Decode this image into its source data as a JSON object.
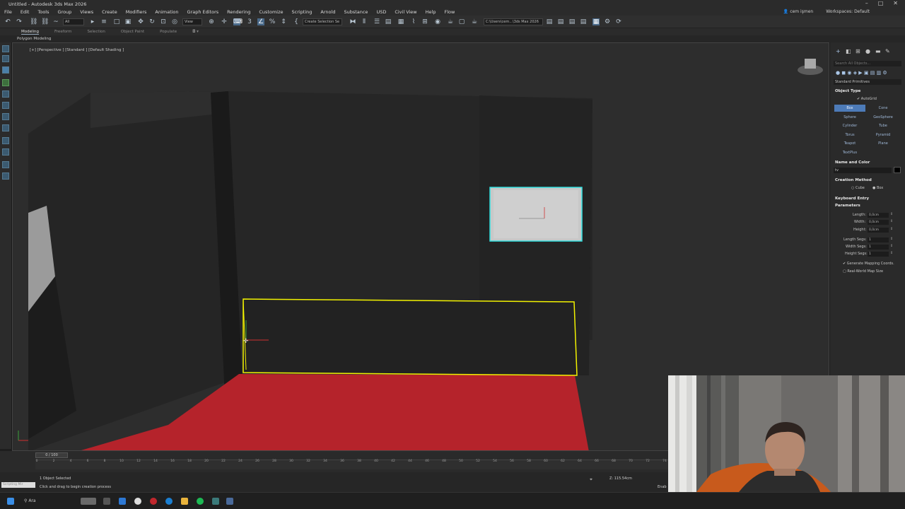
{
  "window": {
    "title": "Untitled - Autodesk 3ds Max 2026"
  },
  "menu": {
    "items": [
      "File",
      "Edit",
      "Tools",
      "Group",
      "Views",
      "Create",
      "Modifiers",
      "Animation",
      "Graph Editors",
      "Rendering",
      "Customize",
      "Scripting",
      "Arnold",
      "Substance",
      "USD",
      "Civil View",
      "Help",
      "Flow"
    ],
    "user": "cem işmen",
    "workspaces_label": "Workspaces:",
    "workspace": "Default"
  },
  "toolbar": {
    "filter": "All",
    "view_dropdown": "View",
    "selection_set": "Create Selection Se",
    "project_path": "C:\\Users\\cem...\\3ds Max 2026"
  },
  "ribbon": {
    "tabs": [
      "Modeling",
      "Freeform",
      "Selection",
      "Object Paint",
      "Populate"
    ],
    "active_tab": "Modeling",
    "sub_label": "Polygon Modeling"
  },
  "viewport": {
    "label": "[+] [Perspective ] [Standard ] [Default Shading ]",
    "filter_icon": "funnel-icon"
  },
  "command_panel": {
    "search_placeholder": "Search All Objects...",
    "category": "Standard Primitives",
    "object_type_header": "Object Type",
    "autogrid_label": "AutoGrid",
    "object_buttons": [
      "Box",
      "Cone",
      "Sphere",
      "GeoSphere",
      "Cylinder",
      "Tube",
      "Torus",
      "Pyramid",
      "Teapot",
      "Plane",
      "TextPlus"
    ],
    "active_button": "Box",
    "name_color_header": "Name and Color",
    "name_value": "tv",
    "object_color": "#000000",
    "creation_method_header": "Creation Method",
    "creation_cube": "Cube",
    "creation_box": "Box",
    "keyboard_entry_header": "Keyboard Entry",
    "parameters_header": "Parameters",
    "length_label": "Length:",
    "length_value": "0,0cm",
    "width_label": "Width:",
    "width_value": "0,0cm",
    "height_label": "Height:",
    "height_value": "0,0cm",
    "length_segs_label": "Length Segs:",
    "length_segs_value": "1",
    "width_segs_label": "Width Segs:",
    "width_segs_value": "1",
    "height_segs_label": "Height Segs:",
    "height_segs_value": "1",
    "gen_mapping_label": "Generate Mapping Coords.",
    "real_world_label": "Real-World Map Size"
  },
  "timeline": {
    "frame_display": "0 / 100",
    "ticks": [
      "0",
      "2",
      "4",
      "6",
      "8",
      "10",
      "12",
      "14",
      "16",
      "18",
      "20",
      "22",
      "24",
      "26",
      "28",
      "30",
      "32",
      "34",
      "36",
      "38",
      "40",
      "42",
      "44",
      "46",
      "48",
      "50",
      "52",
      "54",
      "56",
      "58",
      "60",
      "62",
      "64",
      "66",
      "68",
      "70",
      "72",
      "74"
    ]
  },
  "status": {
    "objects_selected": "1 Object Selected",
    "prompt": "Click and drag to begin creation process",
    "maxscript_placeholder": "Scripting Mir",
    "z_label": "Z:",
    "z_value": "115.54cm",
    "extra_label": "Enab"
  },
  "taskbar": {
    "search_text": "Ara"
  },
  "colors": {
    "selection_yellow": "#f2f200",
    "selection_cyan": "#33e0e0",
    "floor_red": "#b5232b",
    "active_blue": "#4d7bb8"
  }
}
